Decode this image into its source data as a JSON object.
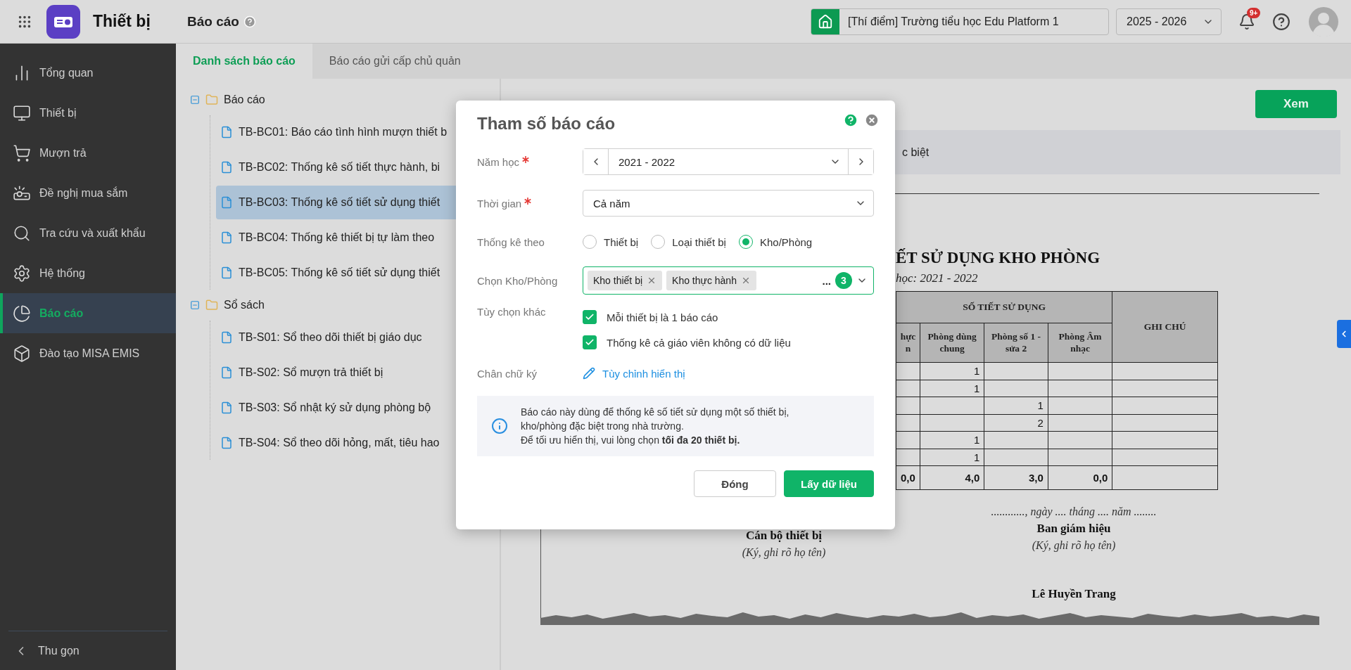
{
  "app": {
    "title": "Thiết bị"
  },
  "page": {
    "title": "Báo cáo"
  },
  "school": "[Thí điểm] Trường tiểu học Edu Platform 1",
  "year": "2025 - 2026",
  "notifications": "9+",
  "sidebar": {
    "items": [
      {
        "label": "Tổng quan",
        "selected": false
      },
      {
        "label": "Thiết bị",
        "selected": false
      },
      {
        "label": "Mượn trả",
        "selected": false
      },
      {
        "label": "Đề nghị mua sắm",
        "selected": false
      },
      {
        "label": "Tra cứu và xuất khẩu",
        "selected": false
      },
      {
        "label": "Hệ thống",
        "selected": false
      },
      {
        "label": "Báo cáo",
        "selected": true
      },
      {
        "label": "Đào tạo MISA EMIS",
        "selected": false
      }
    ],
    "collapse": "Thu gọn"
  },
  "tabs": [
    {
      "label": "Danh sách báo cáo",
      "selected": true
    },
    {
      "label": "Báo cáo gửi cấp chủ quản",
      "selected": false
    }
  ],
  "tree": [
    {
      "label": "Báo cáo",
      "expanded": true,
      "children": [
        {
          "label": "TB-BC01: Báo cáo tình hình mượn thiết b",
          "selected": false
        },
        {
          "label": "TB-BC02: Thống kê số tiết thực hành, bi",
          "selected": false
        },
        {
          "label": "TB-BC03: Thống kê số tiết sử dụng thiết",
          "selected": true
        },
        {
          "label": "TB-BC04: Thống kê thiết bị tự làm theo",
          "selected": false
        },
        {
          "label": "TB-BC05: Thống kê số tiết sử dụng thiết",
          "selected": false
        }
      ]
    },
    {
      "label": "Sổ sách",
      "expanded": true,
      "children": [
        {
          "label": "TB-S01: Sổ theo dõi thiết bị giáo dục",
          "selected": false
        },
        {
          "label": "TB-S02: Sổ mượn trả thiết bị",
          "selected": false
        },
        {
          "label": "TB-S03: Sổ nhật ký sử dụng phòng bộ",
          "selected": false
        },
        {
          "label": "TB-S04: Sổ theo dõi hỏng, mất, tiêu hao",
          "selected": false
        }
      ]
    }
  ],
  "report": {
    "view_button": "Xem",
    "banner": "c biệt",
    "title": "ẾT SỬ DỤNG KHO PHÒNG",
    "subtitle": "học: 2021 - 2022",
    "table": {
      "group_header": "SỐ TIẾT SỬ DỤNG",
      "note_header": "GHI CHÚ",
      "columns": [
        "hực\nn",
        "Phòng dùng chung",
        "Phòng số 1 - sửa 2",
        "Phòng Âm nhạc"
      ],
      "rows": [
        [
          null,
          "1",
          null,
          null
        ],
        [
          null,
          "1",
          null,
          null
        ],
        [
          null,
          null,
          "1",
          null
        ],
        [
          null,
          null,
          "2",
          null
        ],
        [
          null,
          "1",
          null,
          null
        ],
        [
          null,
          "1",
          null,
          null
        ]
      ],
      "totals": [
        "0,0",
        "4,0",
        "3,0",
        "0,0"
      ]
    },
    "signatures": [
      {
        "title": "Cán bộ thiết bị",
        "note": "(Ký, ghi rõ họ tên)"
      },
      {
        "date": "............, ngày .... tháng .... năm ........",
        "title": "Ban giám hiệu",
        "note": "(Ký, ghi rõ họ tên)",
        "name": "Lê Huyền Trang"
      }
    ]
  },
  "dialog": {
    "title": "Tham số báo cáo",
    "fields": [
      {
        "kind": "year",
        "label": "Năm học",
        "required": true,
        "value": "2021 - 2022"
      },
      {
        "kind": "select",
        "label": "Thời gian",
        "required": true,
        "value": "Cả năm"
      },
      {
        "kind": "radio",
        "label": "Thống kê theo",
        "options": [
          {
            "label": "Thiết bị",
            "selected": false
          },
          {
            "label": "Loại thiết bị",
            "selected": false
          },
          {
            "label": "Kho/Phòng",
            "selected": true
          }
        ]
      },
      {
        "kind": "tags",
        "label": "Chọn Kho/Phòng",
        "tags": [
          "Kho thiết bị",
          "Kho thực hành"
        ],
        "more": "...",
        "count": "3"
      },
      {
        "kind": "checks",
        "label": "Tùy chọn khác",
        "options": [
          {
            "label": "Mỗi thiết bị là 1 báo cáo",
            "checked": true
          },
          {
            "label": "Thống kê cả giáo viên không có dữ liệu",
            "checked": true
          }
        ]
      },
      {
        "kind": "link",
        "label": "Chân chữ ký",
        "link": "Tùy chỉnh hiển thị"
      }
    ],
    "info": "Báo cáo này dùng để thống kê số tiết sử dụng một số thiết bị,\nkho/phòng đặc biệt trong nhà trường.\nĐể tối ưu hiển thị, vui lòng chọn **tối đa 20 thiết bị.**",
    "buttons": [
      {
        "kind": "secondary",
        "label": "Đóng"
      },
      {
        "kind": "primary",
        "label": "Lấy dữ liệu"
      }
    ]
  }
}
